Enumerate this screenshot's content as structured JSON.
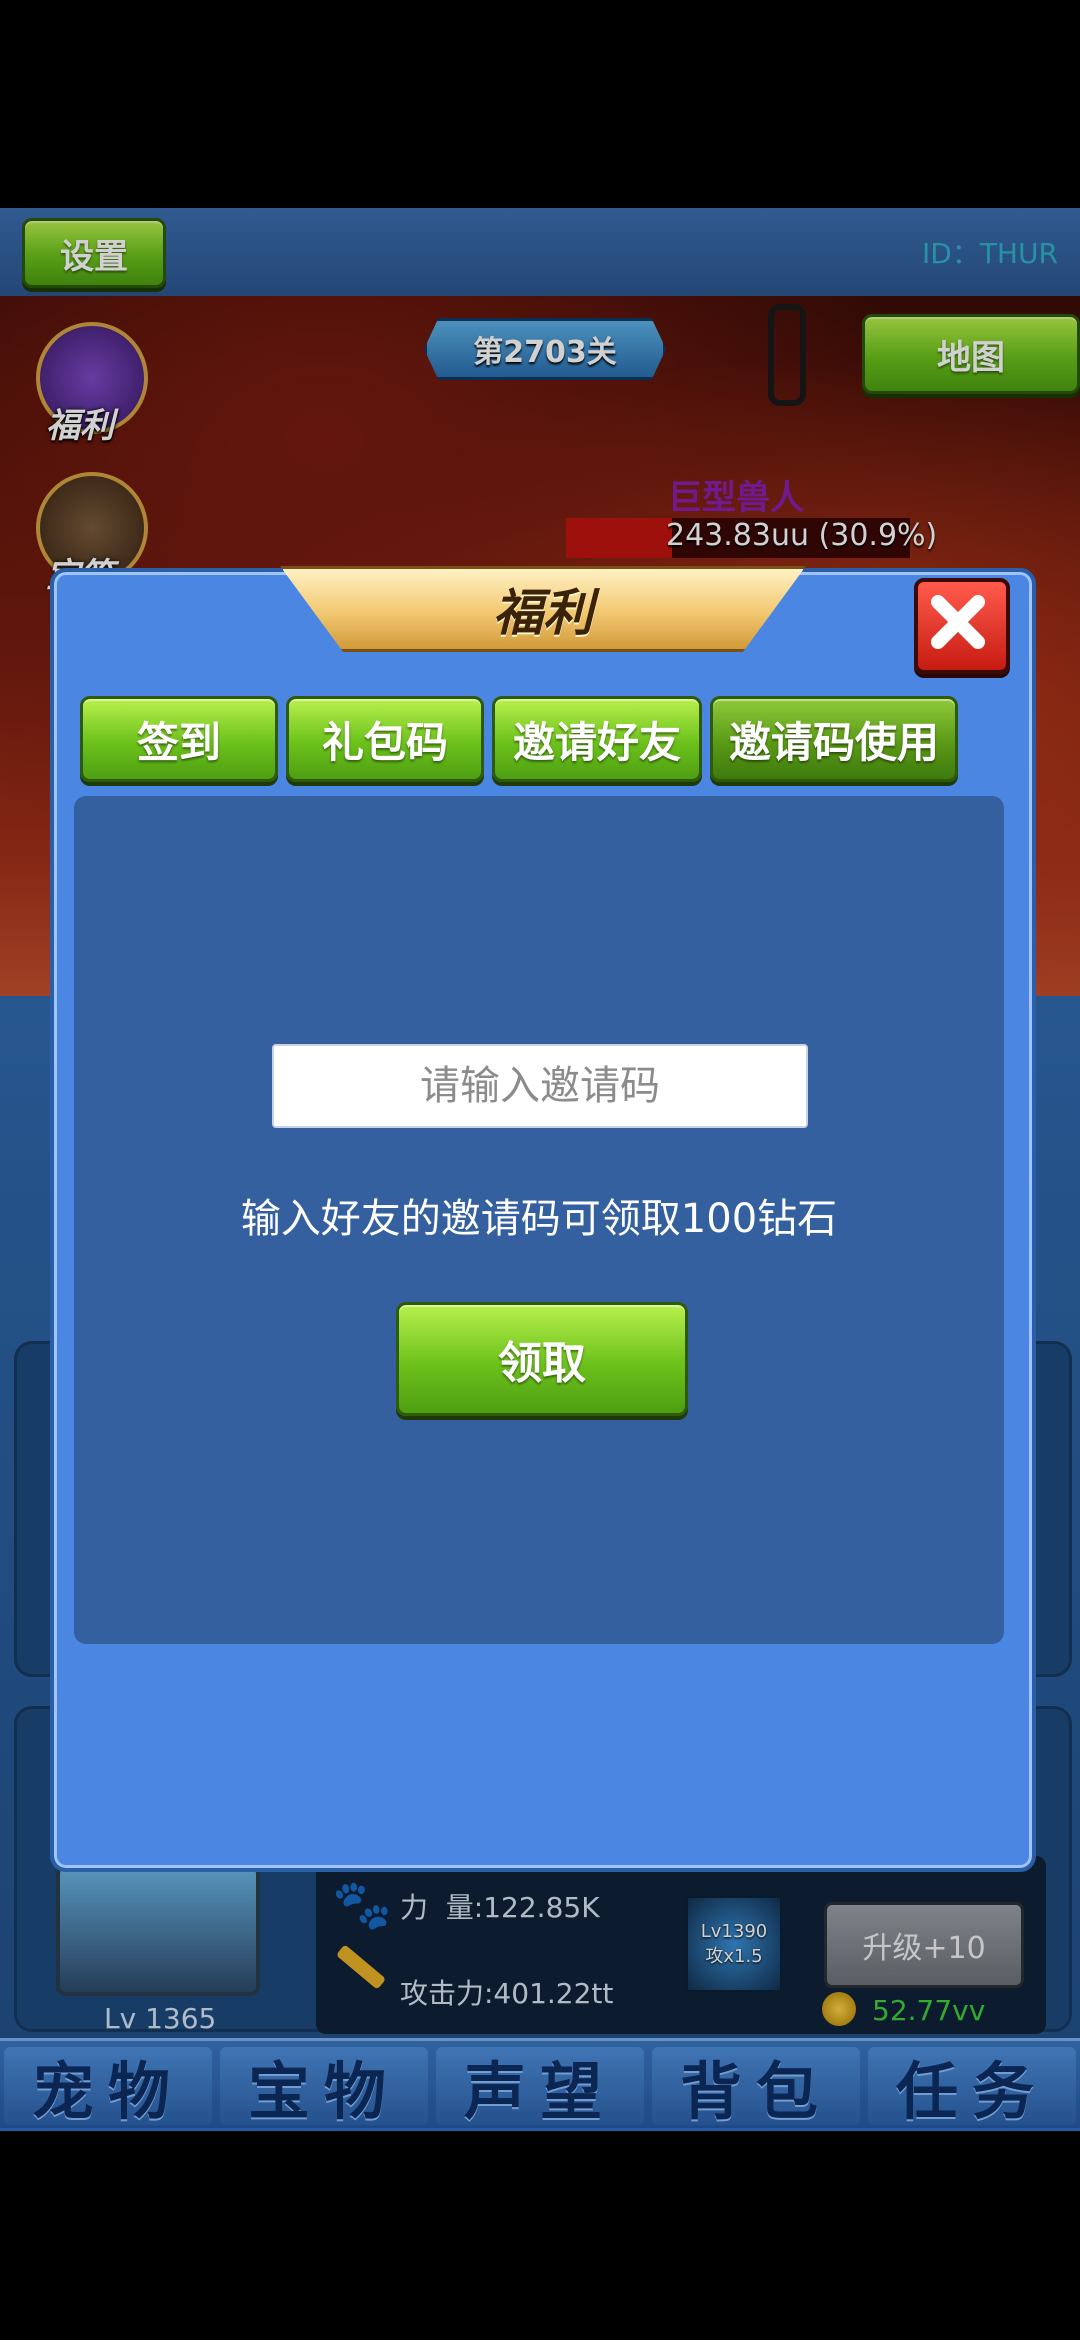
{
  "topbar": {
    "settings_label": "设置",
    "player_id": "ID：THUR"
  },
  "battle": {
    "stage_label": "第2703关",
    "map_label": "地图",
    "side_icons": [
      {
        "label": "福利"
      },
      {
        "label": "宝箱"
      }
    ],
    "enemy_name": "巨型兽人",
    "enemy_hp": "243.83uu (30.9%)",
    "enemy_hp_fraction": 0.309
  },
  "pet_panel": {
    "level": "Lv 1365",
    "power": "力  量:122.85K",
    "attack": "攻击力:401.22tt",
    "skill_level": "Lv1390",
    "skill_bonus": "攻x1.5",
    "upgrade_label": "升级+10",
    "upgrade_cost": "52.77vv"
  },
  "bottom_tabs": [
    "宠物",
    "宝物",
    "声望",
    "背包",
    "任务"
  ],
  "modal": {
    "title": "福利",
    "tabs": [
      "签到",
      "礼包码",
      "邀请好友",
      "邀请码使用"
    ],
    "active_tab": "邀请码使用",
    "input_placeholder": "请输入邀请码",
    "description": "输入好友的邀请码可领取100钻石",
    "claim_label": "领取"
  },
  "colors": {
    "modal_bg": "#4a86e2",
    "content_bg": "#3460a0",
    "button_green": "#6cc11b",
    "hp_bar": "#c0140e"
  }
}
